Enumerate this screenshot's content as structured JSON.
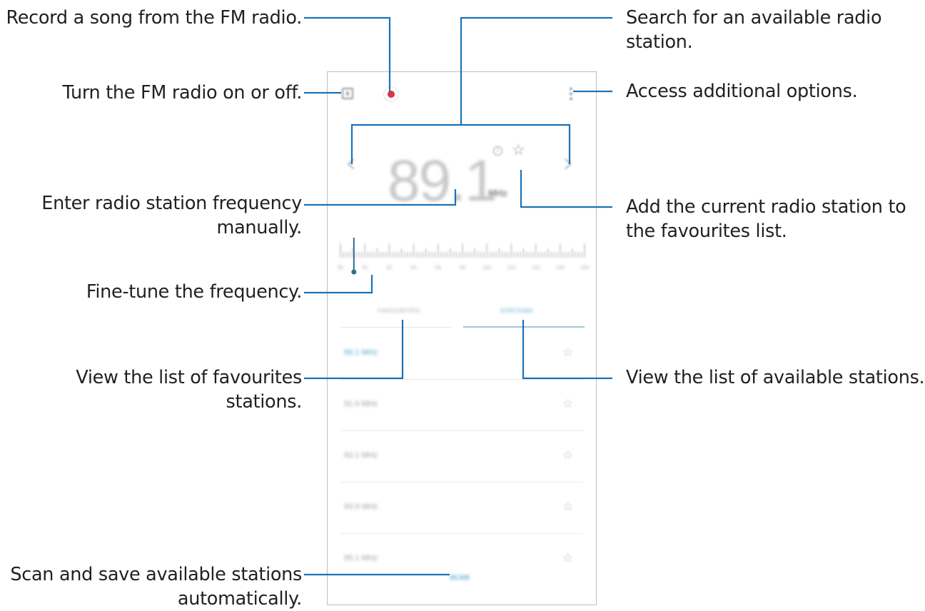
{
  "colors": {
    "annotation_line": "#1a73b8",
    "accent": "#3ea0c4",
    "record": "#e0333f"
  },
  "callouts": {
    "record": "Record a song from the FM radio.",
    "power": "Turn the FM radio on or off.",
    "frequency_line1": "Enter radio station frequency",
    "frequency_line2": "manually.",
    "finetune": "Fine-tune the frequency.",
    "favourites_line1": "View the list of favourites",
    "favourites_line2": "stations.",
    "scan_line1": "Scan and save available stations",
    "scan_line2": "automatically.",
    "search_line1": "Search for an available radio",
    "search_line2": "station.",
    "options": "Access additional options.",
    "add_fav_line1": "Add the current radio station to",
    "add_fav_line2": "the favourites list.",
    "stations": "View the list of available stations."
  },
  "app": {
    "toolbar": {
      "power_icon": "power-toggle-icon",
      "record_icon": "record-icon",
      "more_icon": "more-options-icon"
    },
    "tuner": {
      "prev_symbol": "‹",
      "next_symbol": "›",
      "frequency": "89.1",
      "unit": "MHz",
      "info_symbol": "i",
      "fav_symbol": "☆",
      "scale_labels": [
        "88",
        "90",
        "92",
        "94",
        "96",
        "98",
        "100",
        "102",
        "104",
        "106",
        "108"
      ],
      "current_position": 0.055
    },
    "tabs": {
      "favourites": "FAVOURITES",
      "stations": "STATIONS",
      "selected": "stations"
    },
    "stations": [
      {
        "name": "89.1 MHz",
        "active": true
      },
      {
        "name": "91.9 MHz",
        "active": false
      },
      {
        "name": "93.1 MHz",
        "active": false
      },
      {
        "name": "93.9 MHz",
        "active": false
      },
      {
        "name": "95.1 MHz",
        "active": false
      }
    ],
    "station_star": "☆",
    "scan_label": "SCAN"
  }
}
